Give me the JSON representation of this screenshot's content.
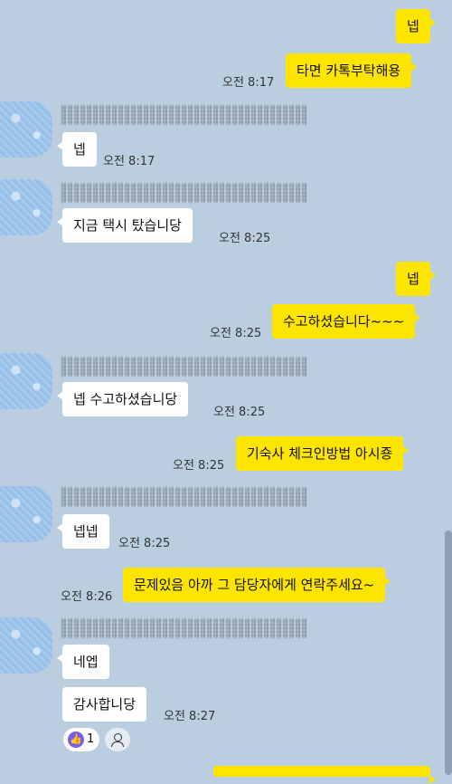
{
  "chat": {
    "m1": {
      "text": "넵"
    },
    "m2": {
      "text": "타면 카톡부탁해용",
      "time": "오전 8:17"
    },
    "m3": {
      "text": "넵",
      "time": "오전 8:17"
    },
    "m4": {
      "text": "지금 택시 탔습니당",
      "time": "오전 8:25"
    },
    "m5": {
      "text": "넵"
    },
    "m6": {
      "text": "수고하셨습니다~~~",
      "time": "오전 8:25"
    },
    "m7": {
      "text": "넵 수고하셨습니당",
      "time": "오전 8:25"
    },
    "m8": {
      "text": "기숙사 체크인방법 아시죵",
      "time": "오전 8:25"
    },
    "m9": {
      "text": "넵넵",
      "time": "오전 8:25"
    },
    "m10": {
      "text": "문제있음 아까 그 담당자에게 연락주세요~",
      "time": "오전 8:26"
    },
    "m11": {
      "text": "네엡"
    },
    "m12": {
      "text": "감사합니당",
      "time": "오전 8:27"
    }
  },
  "reaction": {
    "icon": "thumbs-up-icon",
    "count": "1"
  },
  "colors": {
    "background": "#bacee0",
    "my_bubble": "#fee500",
    "their_bubble": "#ffffff"
  }
}
